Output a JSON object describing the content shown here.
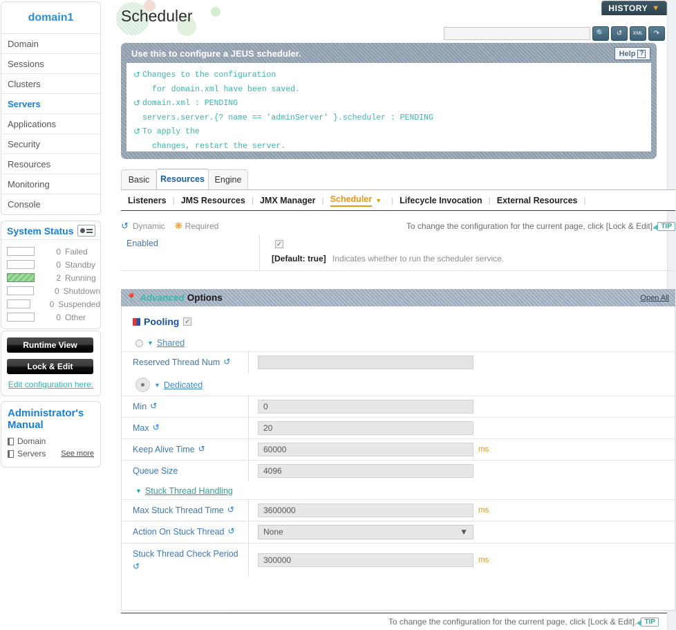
{
  "sidebar": {
    "domain_title": "domain1",
    "nav_items": [
      {
        "label": "Domain",
        "active": false
      },
      {
        "label": "Sessions",
        "active": false
      },
      {
        "label": "Clusters",
        "active": false
      },
      {
        "label": "Servers",
        "active": true
      },
      {
        "label": "Applications",
        "active": false
      },
      {
        "label": "Security",
        "active": false
      },
      {
        "label": "Resources",
        "active": false
      },
      {
        "label": "Monitoring",
        "active": false
      },
      {
        "label": "Console",
        "active": false
      }
    ],
    "system_status": {
      "title": "System Status",
      "rows": [
        {
          "count": "0",
          "label": "Failed",
          "filled": false
        },
        {
          "count": "0",
          "label": "Standby",
          "filled": false
        },
        {
          "count": "2",
          "label": "Running",
          "filled": true
        },
        {
          "count": "0",
          "label": "Shutdown",
          "filled": false
        },
        {
          "count": "0",
          "label": "Suspended",
          "filled": false
        },
        {
          "count": "0",
          "label": "Other",
          "filled": false
        }
      ]
    },
    "runtime_view_label": "Runtime View",
    "lock_edit_label": "Lock & Edit",
    "edit_config_label": "Edit configuration here.",
    "manual": {
      "title": "Administrator's Manual",
      "items": [
        "Domain",
        "Servers"
      ],
      "see_more": "See more"
    }
  },
  "header": {
    "page_title": "Scheduler",
    "history_label": "HISTORY",
    "search_value": "",
    "search_placeholder": ""
  },
  "info_panel": {
    "heading": "Use this to configure a JEUS scheduler.",
    "help_label": "Help",
    "lines": [
      {
        "icon": true,
        "indent": 0,
        "text": "Changes to the configuration"
      },
      {
        "icon": false,
        "indent": 2,
        "text": "for domain.xml have been saved."
      },
      {
        "icon": true,
        "indent": 0,
        "text": "domain.xml : PENDING"
      },
      {
        "icon": false,
        "indent": 1,
        "text": "servers.server.{? name == 'adminServer' }.scheduler : PENDING"
      },
      {
        "icon": true,
        "indent": 0,
        "text": "To apply the"
      },
      {
        "icon": false,
        "indent": 2,
        "text": "changes, restart the server."
      }
    ]
  },
  "tabs": [
    {
      "label": "Basic",
      "active": false
    },
    {
      "label": "Resources",
      "active": true
    },
    {
      "label": "Engine",
      "active": false
    }
  ],
  "subnav": [
    {
      "label": "Listeners",
      "active": false
    },
    {
      "label": "JMS Resources",
      "active": false
    },
    {
      "label": "JMX Manager",
      "active": false
    },
    {
      "label": "Scheduler",
      "active": true
    },
    {
      "label": "Lifecycle Invocation",
      "active": false
    },
    {
      "label": "External Resources",
      "active": false
    }
  ],
  "legend": {
    "dynamic": "Dynamic",
    "required": "Required",
    "tip_text": "To change the configuration for the current page, click [Lock & Edit].",
    "tip_badge": "TIP"
  },
  "enabled": {
    "label": "Enabled",
    "checked": true,
    "default_text": "[Default: true]",
    "description": "Indicates whether to run the scheduler service."
  },
  "advanced": {
    "italic_word": "Advanced",
    "plain_word": "Options",
    "open_all": "Open All",
    "pooling": {
      "label": "Pooling",
      "checked": true,
      "shared": {
        "label": "Shared",
        "selected": false,
        "fields": [
          {
            "label": "Reserved Thread Num",
            "dynamic": true,
            "value": "",
            "type": "text",
            "unit": ""
          }
        ]
      },
      "dedicated": {
        "label": "Dedicated",
        "selected": true,
        "fields": [
          {
            "label": "Min",
            "dynamic": true,
            "value": "0",
            "type": "text",
            "unit": ""
          },
          {
            "label": "Max",
            "dynamic": true,
            "value": "20",
            "type": "text",
            "unit": ""
          },
          {
            "label": "Keep Alive Time",
            "dynamic": true,
            "value": "60000",
            "type": "text",
            "unit": "ms"
          },
          {
            "label": "Queue Size",
            "dynamic": false,
            "value": "4096",
            "type": "text",
            "unit": ""
          }
        ]
      },
      "stuck_thread": {
        "label": "Stuck Thread Handling",
        "fields": [
          {
            "label": "Max Stuck Thread Time",
            "dynamic": true,
            "value": "3600000",
            "type": "text",
            "unit": "ms"
          },
          {
            "label": "Action On Stuck Thread",
            "dynamic": true,
            "value": "None",
            "type": "select",
            "unit": ""
          },
          {
            "label": "Stuck Thread Check Period",
            "dynamic": true,
            "value": "300000",
            "type": "text",
            "unit": "ms"
          }
        ]
      }
    }
  },
  "footer": {
    "text": "To change the configuration for the current page, click [Lock & Edit].",
    "tip_badge": "TIP"
  },
  "colors": {
    "accent_blue": "#1a7fd4",
    "accent_teal": "#3bb6ab",
    "accent_orange": "#e8960f",
    "panel_gray": "#8c9bab"
  }
}
